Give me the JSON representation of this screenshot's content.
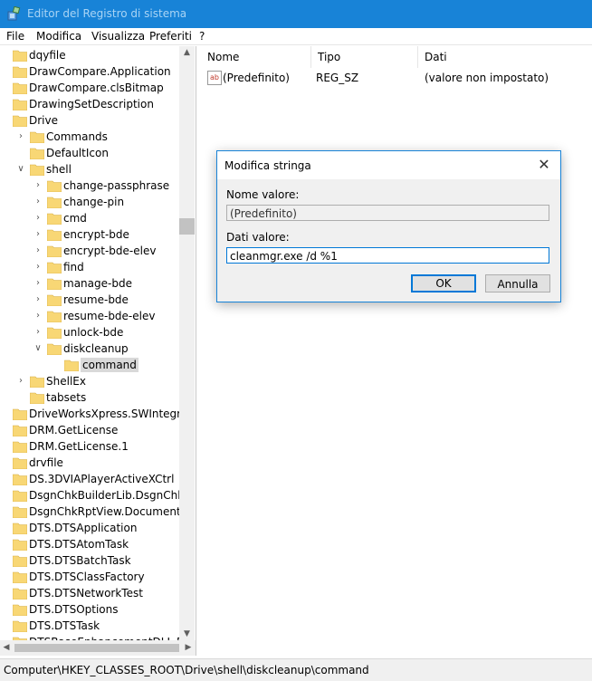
{
  "window": {
    "title": "Editor del Registro di sistema"
  },
  "menu": [
    "File",
    "Modifica",
    "Visualizza",
    "Preferiti",
    "?"
  ],
  "tree": [
    {
      "label": "dqyfile",
      "indent": 0,
      "expander": ""
    },
    {
      "label": "DrawCompare.Application",
      "indent": 0,
      "expander": ""
    },
    {
      "label": "DrawCompare.clsBitmap",
      "indent": 0,
      "expander": ""
    },
    {
      "label": "DrawingSetDescription",
      "indent": 0,
      "expander": ""
    },
    {
      "label": "Drive",
      "indent": 0,
      "expander": ""
    },
    {
      "label": "Commands",
      "indent": 1,
      "expander": "collapsed"
    },
    {
      "label": "DefaultIcon",
      "indent": 1,
      "expander": ""
    },
    {
      "label": "shell",
      "indent": 1,
      "expander": "expanded"
    },
    {
      "label": "change-passphrase",
      "indent": 2,
      "expander": "collapsed"
    },
    {
      "label": "change-pin",
      "indent": 2,
      "expander": "collapsed"
    },
    {
      "label": "cmd",
      "indent": 2,
      "expander": "collapsed"
    },
    {
      "label": "encrypt-bde",
      "indent": 2,
      "expander": "collapsed"
    },
    {
      "label": "encrypt-bde-elev",
      "indent": 2,
      "expander": "collapsed"
    },
    {
      "label": "find",
      "indent": 2,
      "expander": "collapsed"
    },
    {
      "label": "manage-bde",
      "indent": 2,
      "expander": "collapsed"
    },
    {
      "label": "resume-bde",
      "indent": 2,
      "expander": "collapsed"
    },
    {
      "label": "resume-bde-elev",
      "indent": 2,
      "expander": "collapsed"
    },
    {
      "label": "unlock-bde",
      "indent": 2,
      "expander": "collapsed"
    },
    {
      "label": "diskcleanup",
      "indent": 2,
      "expander": "expanded"
    },
    {
      "label": "command",
      "indent": 3,
      "expander": "",
      "selected": true
    },
    {
      "label": "ShellEx",
      "indent": 1,
      "expander": "collapsed"
    },
    {
      "label": "tabsets",
      "indent": 1,
      "expander": ""
    },
    {
      "label": "DriveWorksXpress.SWIntegratio",
      "indent": 0,
      "expander": ""
    },
    {
      "label": "DRM.GetLicense",
      "indent": 0,
      "expander": ""
    },
    {
      "label": "DRM.GetLicense.1",
      "indent": 0,
      "expander": ""
    },
    {
      "label": "drvfile",
      "indent": 0,
      "expander": ""
    },
    {
      "label": "DS.3DVIAPlayerActiveXCtrl",
      "indent": 0,
      "expander": ""
    },
    {
      "label": "DsgnChkBuilderLib.DsgnChkBu",
      "indent": 0,
      "expander": ""
    },
    {
      "label": "DsgnChkRptView.Document",
      "indent": 0,
      "expander": ""
    },
    {
      "label": "DTS.DTSApplication",
      "indent": 0,
      "expander": ""
    },
    {
      "label": "DTS.DTSAtomTask",
      "indent": 0,
      "expander": ""
    },
    {
      "label": "DTS.DTSBatchTask",
      "indent": 0,
      "expander": ""
    },
    {
      "label": "DTS.DTSClassFactory",
      "indent": 0,
      "expander": ""
    },
    {
      "label": "DTS.DTSNetworkTest",
      "indent": 0,
      "expander": ""
    },
    {
      "label": "DTS.DTSOptions",
      "indent": 0,
      "expander": ""
    },
    {
      "label": "DTS.DTSTask",
      "indent": 0,
      "expander": ""
    },
    {
      "label": "DTSBaseEnhancementDLL.DTSB",
      "indent": 0,
      "expander": ""
    }
  ],
  "list": {
    "headers": {
      "name": "Nome",
      "type": "Tipo",
      "data": "Dati"
    },
    "rows": [
      {
        "name": "(Predefinito)",
        "type": "REG_SZ",
        "data": "(valore non impostato)",
        "icon": "string-value-icon"
      }
    ]
  },
  "status": {
    "path": "Computer\\HKEY_CLASSES_ROOT\\Drive\\shell\\diskcleanup\\command"
  },
  "dialog": {
    "title": "Modifica stringa",
    "name_label": "Nome valore:",
    "name_value": "(Predefinito)",
    "data_label": "Dati valore:",
    "data_value": "cleanmgr.exe /d %1",
    "ok": "OK",
    "cancel": "Annulla"
  },
  "colors": {
    "accent": "#1883d7",
    "folder": "#f8d775"
  }
}
